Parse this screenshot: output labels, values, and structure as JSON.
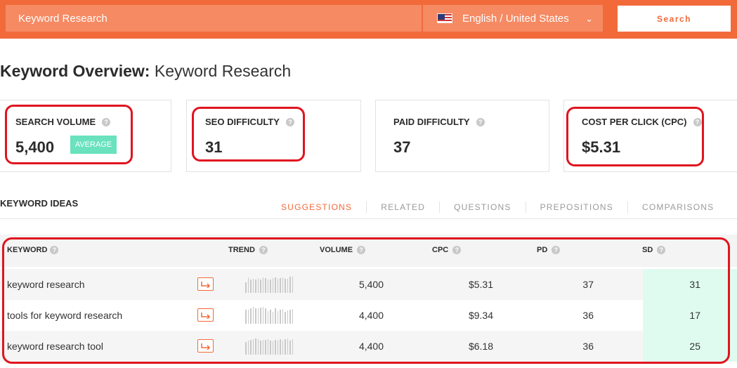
{
  "search": {
    "keyword_value": "Keyword Research",
    "language": "English / United States",
    "search_label": "Search"
  },
  "overview": {
    "title_bold": "Keyword Overview:",
    "title_keyword": "Keyword Research"
  },
  "metrics": [
    {
      "label": "SEARCH VOLUME",
      "value": "5,400",
      "badge": "AVERAGE"
    },
    {
      "label": "SEO DIFFICULTY",
      "value": "31"
    },
    {
      "label": "PAID DIFFICULTY",
      "value": "37"
    },
    {
      "label": "COST PER CLICK (CPC)",
      "value": "$5.31"
    }
  ],
  "ideas": {
    "title": "KEYWORD IDEAS",
    "tabs": [
      "SUGGESTIONS",
      "RELATED",
      "QUESTIONS",
      "PREPOSITIONS",
      "COMPARISONS"
    ],
    "active_tab": "SUGGESTIONS"
  },
  "table": {
    "columns": [
      "KEYWORD",
      "TREND",
      "VOLUME",
      "CPC",
      "PD",
      "SD"
    ],
    "rows": [
      {
        "keyword": "keyword research",
        "volume": "5,400",
        "cpc": "$5.31",
        "pd": "37",
        "sd": "31"
      },
      {
        "keyword": "tools for keyword research",
        "volume": "4,400",
        "cpc": "$9.34",
        "pd": "36",
        "sd": "17"
      },
      {
        "keyword": "keyword research tool",
        "volume": "4,400",
        "cpc": "$6.18",
        "pd": "36",
        "sd": "25"
      }
    ]
  },
  "colors": {
    "accent": "#f26a3a",
    "highlight": "#e0141e",
    "badge": "#69e2bd",
    "sd_column": "#dffbef"
  },
  "icons": [
    "us-flag-icon",
    "chevron-down-icon",
    "help-icon",
    "trend-sparkline",
    "arrow-icon"
  ]
}
